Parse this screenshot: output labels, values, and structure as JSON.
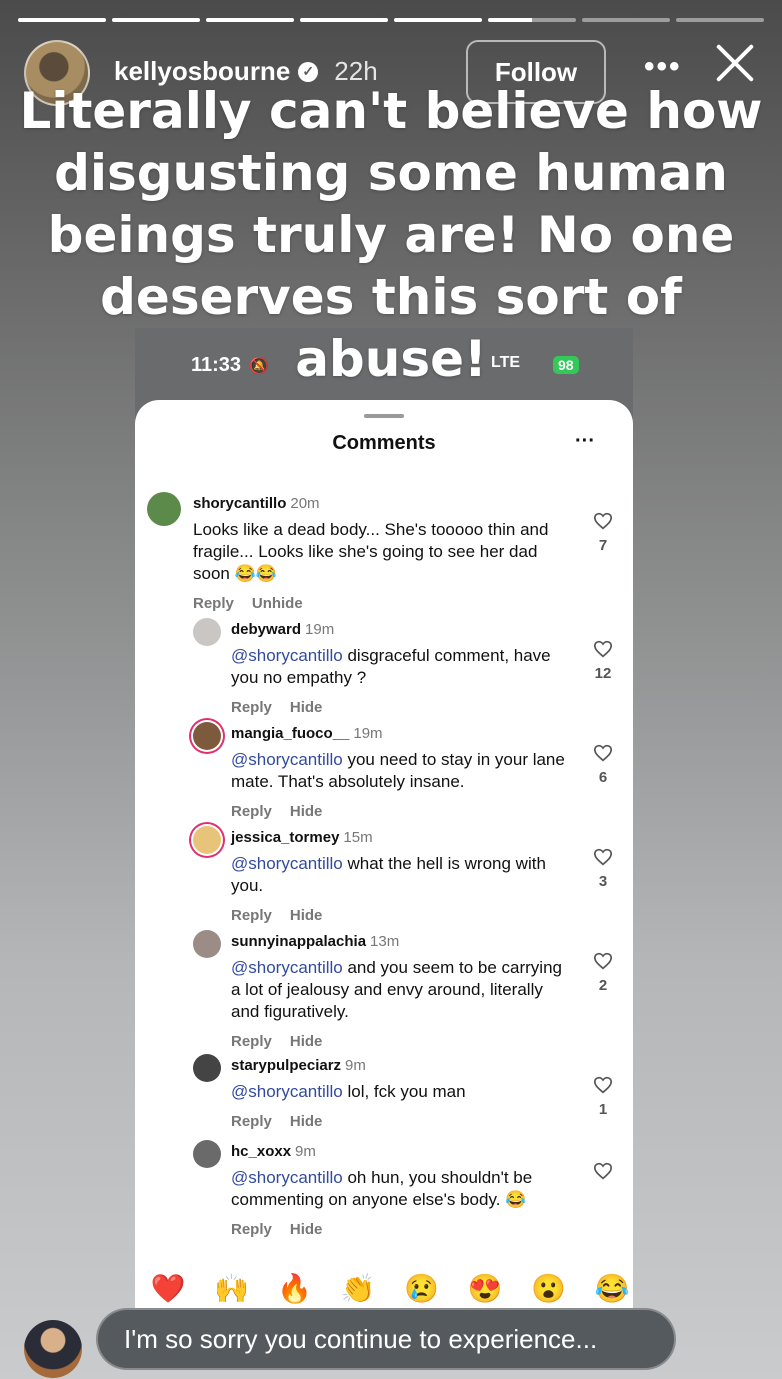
{
  "story": {
    "username": "kellyosbourne",
    "time": "22h",
    "follow_label": "Follow",
    "overlay_text": "Literally can't believe how disgusting some human beings truly are! No one deserves this sort of abuse!",
    "progress_segments": 8,
    "progress_done": 5
  },
  "screenshot": {
    "status_time": "11:33",
    "status_network": "LTE",
    "battery": "98",
    "title": "Comments",
    "comments": [
      {
        "user": "shorycantillo",
        "time": "20m",
        "mention": "",
        "text": "Looks like a dead body... She's tooooo thin and fragile... Looks like she's going to see her dad soon 😂😂",
        "reply": "Reply",
        "action": "Unhide",
        "likes": "7"
      },
      {
        "user": "debyward",
        "time": "19m",
        "mention": "@shorycantillo",
        "text": " disgraceful comment, have you no empathy ?",
        "reply": "Reply",
        "action": "Hide",
        "likes": "12"
      },
      {
        "user": "mangia_fuoco__",
        "time": "19m",
        "mention": "@shorycantillo",
        "text": " you need to stay in your lane mate. That's absolutely insane.",
        "reply": "Reply",
        "action": "Hide",
        "likes": "6"
      },
      {
        "user": "jessica_tormey",
        "time": "15m",
        "mention": "@shorycantillo",
        "text": " what the hell is wrong with you.",
        "reply": "Reply",
        "action": "Hide",
        "likes": "3"
      },
      {
        "user": "sunnyinappalachia",
        "time": "13m",
        "mention": "@shorycantillo",
        "text": " and you seem to be carrying a lot of jealousy and envy around, literally and figuratively.",
        "reply": "Reply",
        "action": "Hide",
        "likes": "2"
      },
      {
        "user": "starypulpeciarz",
        "time": "9m",
        "mention": "@shorycantillo",
        "text": " lol, fck you man",
        "reply": "Reply",
        "action": "Hide",
        "likes": "1"
      },
      {
        "user": "hc_xoxx",
        "time": "9m",
        "mention": "@shorycantillo",
        "text": " oh hun, you shouldn't be commenting on anyone else's body. 😂",
        "reply": "Reply",
        "action": "Hide",
        "likes": ""
      }
    ]
  },
  "reactions": [
    "❤️",
    "🙌",
    "🔥",
    "👏",
    "😢",
    "😍",
    "😮",
    "😂"
  ],
  "reply_input": {
    "placeholder": "I'm so sorry you continue to experience..."
  }
}
